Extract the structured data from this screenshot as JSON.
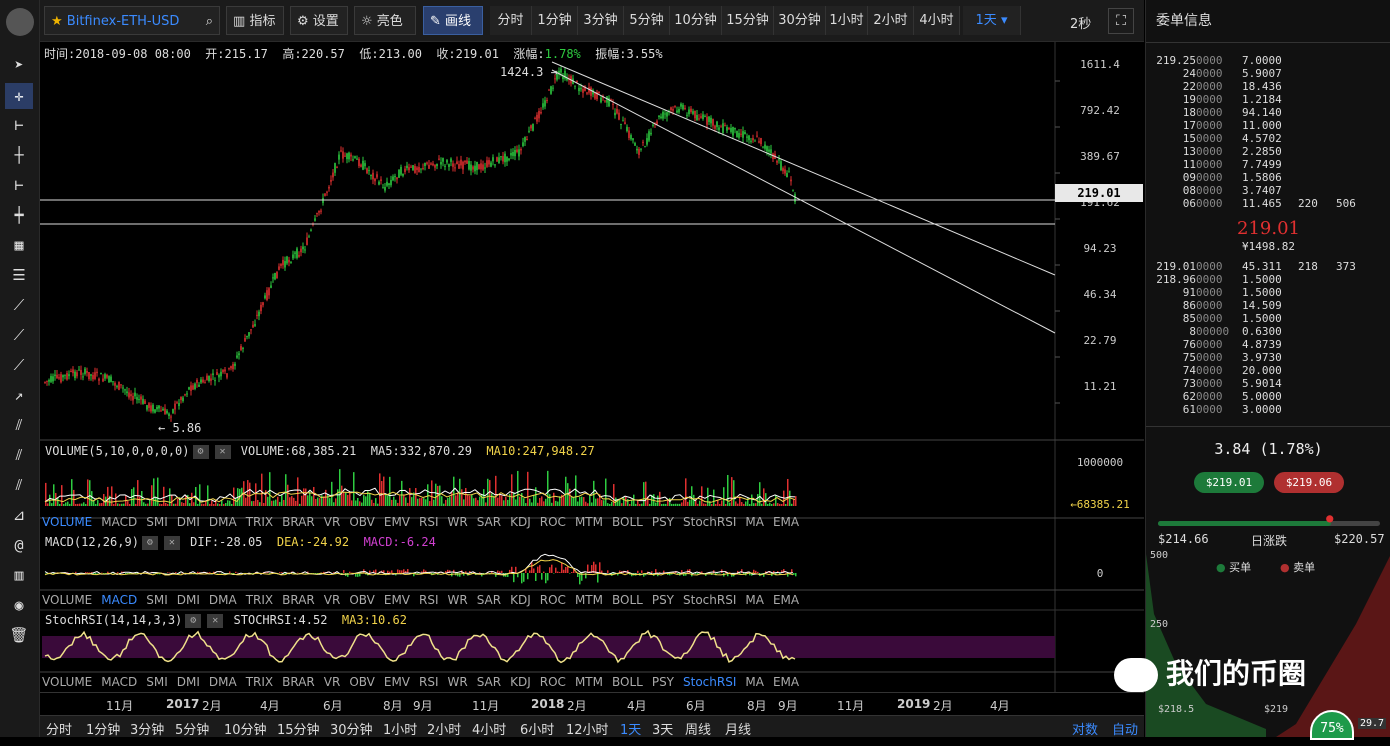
{
  "toolbar": {
    "symbol": "Bitfinex-ETH-USD",
    "indicators_label": "指标",
    "settings_label": "设置",
    "bright_label": "亮色",
    "draw_label": "画线",
    "intervals": [
      "分时",
      "1分钟",
      "3分钟",
      "5分钟",
      "10分钟",
      "15分钟",
      "30分钟",
      "1小时",
      "2小时",
      "4小时"
    ],
    "selected_interval": "1天",
    "refresh": "2秒"
  },
  "info": {
    "time": "时间:2018-09-08 08:00",
    "open": "开:215.17",
    "high": "高:220.57",
    "low": "低:213.00",
    "close": "收:219.01",
    "change_label": "涨幅:",
    "change_value": "1.78%",
    "amplitude": "振幅:3.55%"
  },
  "price_axis": [
    "1611.4",
    "792.42",
    "389.67",
    "191.62",
    "94.23",
    "46.34",
    "22.79",
    "11.21"
  ],
  "current_price_tag": "219.01",
  "annotations": {
    "high": "1424.3 →",
    "low": "← 5.86"
  },
  "volume": {
    "title": "VOLUME(5,10,0,0,0,0)",
    "value": "VOLUME:68,385.21",
    "ma5": "MA5:332,870.29",
    "ma10": "MA10:247,948.27",
    "axis_top": "1000000",
    "axis_tag": "←68385.21"
  },
  "macd": {
    "title": "MACD(12,26,9)",
    "dif": "DIF:-28.05",
    "dea": "DEA:-24.92",
    "macd": "MACD:-6.24",
    "axis_zero": "0"
  },
  "stochrsi": {
    "title": "StochRSI(14,14,3,3)",
    "value": "STOCHRSI:4.52",
    "ma3": "MA3:10.62"
  },
  "indicator_tabs": [
    "VOLUME",
    "MACD",
    "SMI",
    "DMI",
    "DMA",
    "TRIX",
    "BRAR",
    "VR",
    "OBV",
    "EMV",
    "RSI",
    "WR",
    "SAR",
    "KDJ",
    "ROC",
    "MTM",
    "BOLL",
    "PSY",
    "StochRSI",
    "MA",
    "EMA"
  ],
  "x_axis": [
    "11月",
    "2017",
    "2月",
    "4月",
    "6月",
    "8月",
    "9月",
    "11月",
    "2018",
    "2月",
    "4月",
    "6月",
    "8月",
    "9月",
    "11月",
    "2019",
    "2月",
    "4月"
  ],
  "bottom_intervals": [
    "分时",
    "1分钟",
    "3分钟",
    "5分钟",
    "10分钟",
    "15分钟",
    "30分钟",
    "1小时",
    "2小时",
    "4小时",
    "6小时",
    "12小时",
    "1天",
    "3天",
    "周线",
    "月线"
  ],
  "bottom_selected": "1天",
  "bottom_right": [
    "对数",
    "自动"
  ],
  "orderbook": {
    "title": "委单信息",
    "asks": [
      [
        "219.25",
        "0000",
        "7.0000",
        "",
        ""
      ],
      [
        "24",
        "0000",
        "5.9007",
        "",
        ""
      ],
      [
        "22",
        "0000",
        "18.436",
        "",
        ""
      ],
      [
        "19",
        "0000",
        "1.2184",
        "",
        ""
      ],
      [
        "18",
        "0000",
        "94.140",
        "",
        ""
      ],
      [
        "17",
        "0000",
        "11.000",
        "",
        ""
      ],
      [
        "15",
        "0000",
        "4.5702",
        "",
        ""
      ],
      [
        "13",
        "0000",
        "2.2850",
        "",
        ""
      ],
      [
        "11",
        "0000",
        "7.7499",
        "",
        ""
      ],
      [
        "09",
        "0000",
        "1.5806",
        "",
        ""
      ],
      [
        "08",
        "0000",
        "3.7407",
        "",
        ""
      ],
      [
        "06",
        "0000",
        "11.465",
        "220",
        "506"
      ]
    ],
    "last_price": "219.01",
    "last_price_cny": "¥1498.82",
    "bids": [
      [
        "219.01",
        "0000",
        "45.311",
        "218",
        "373"
      ],
      [
        "218.96",
        "0000",
        "1.5000",
        "",
        ""
      ],
      [
        "91",
        "0000",
        "1.5000",
        "",
        ""
      ],
      [
        "86",
        "0000",
        "14.509",
        "",
        ""
      ],
      [
        "85",
        "0000",
        "1.5000",
        "",
        ""
      ],
      [
        "8",
        "00000",
        "0.6300",
        "",
        ""
      ],
      [
        "76",
        "0000",
        "4.8739",
        "",
        ""
      ],
      [
        "75",
        "0000",
        "3.9730",
        "",
        ""
      ],
      [
        "74",
        "0000",
        "20.000",
        "",
        ""
      ],
      [
        "73",
        "0000",
        "5.9014",
        "",
        ""
      ],
      [
        "62",
        "0000",
        "5.0000",
        "",
        ""
      ],
      [
        "61",
        "0000",
        "3.0000",
        "",
        ""
      ]
    ]
  },
  "ticker": {
    "change": "3.84 (1.78%)",
    "buy_price": "$219.01",
    "sell_price": "$219.06",
    "low": "$214.66",
    "range_label": "日涨跌",
    "high": "$220.57",
    "range_position": 0.78
  },
  "depth": {
    "y_labels": [
      "500",
      "250"
    ],
    "legend_buy": "买单",
    "legend_sell": "卖单",
    "x_left": "$218.5",
    "x_mid": "$219",
    "x_right": "29.7",
    "badge": "75%"
  },
  "watermark": "我们的币圈",
  "colors": {
    "up": "#2ecc40",
    "down": "#e03030",
    "accent": "#3b8bff",
    "ma10": "#f1d34a",
    "stoch": "#f0e08a",
    "stoch_band": "#3a0a3a"
  }
}
